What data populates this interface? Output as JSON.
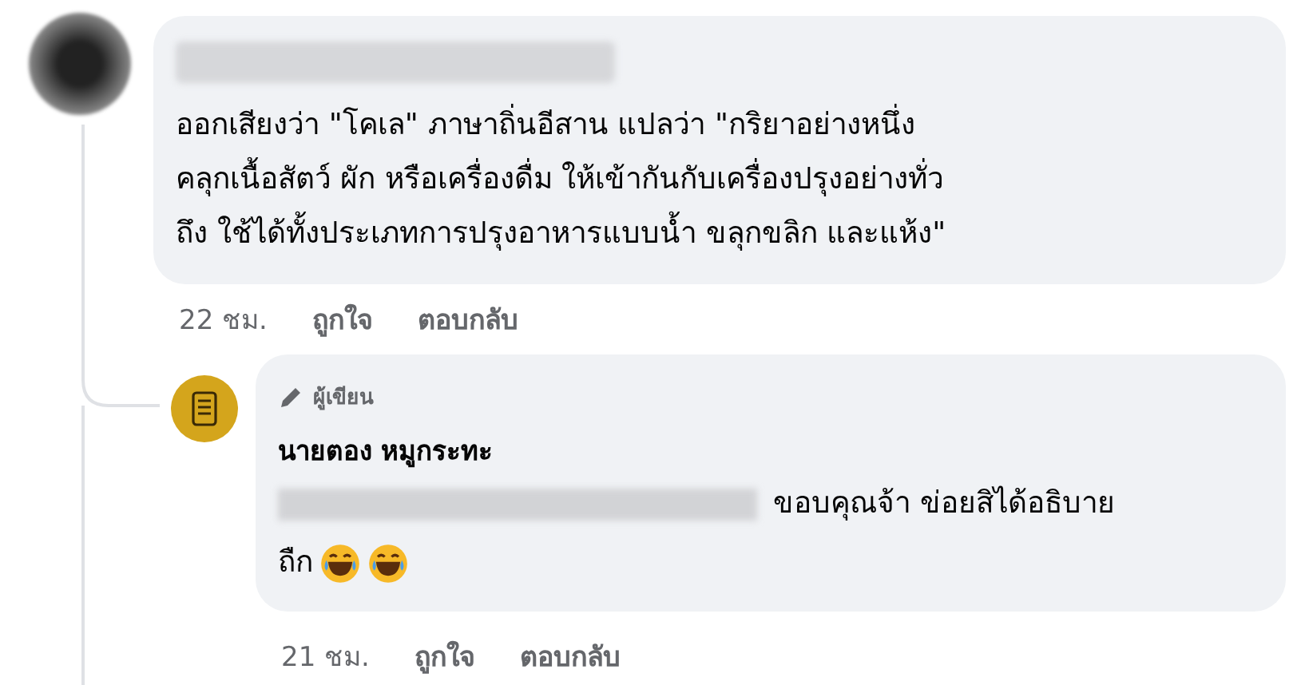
{
  "comment": {
    "text": "ออกเสียงว่า \"โคเล\" ภาษาถิ่นอีสาน แปลว่า \"กริยาอย่างหนึ่ง\nคลุกเนื้อสัตว์ ผัก หรือเครื่องดื่ม ให้เข้ากันกับเครื่องปรุงอย่างทั่ว\nถึง ใช้ได้ทั้งประเภทการปรุงอาหารแบบน้ำ ขลุกขลิก และแห้ง\"",
    "time": "22 ชม.",
    "actions": [
      "ถูกใจ",
      "ตอบกลับ"
    ]
  },
  "reply": {
    "badge": "ผู้เขียน",
    "author": "นายตอง หมูกระทะ",
    "text_lines": [
      "ขอบคุณจ้า ข่อยสิได้อธิบาย",
      "ถืก"
    ],
    "time": "21 ชม.",
    "actions": [
      "ถูกใจ",
      "ตอบกลับ"
    ]
  }
}
